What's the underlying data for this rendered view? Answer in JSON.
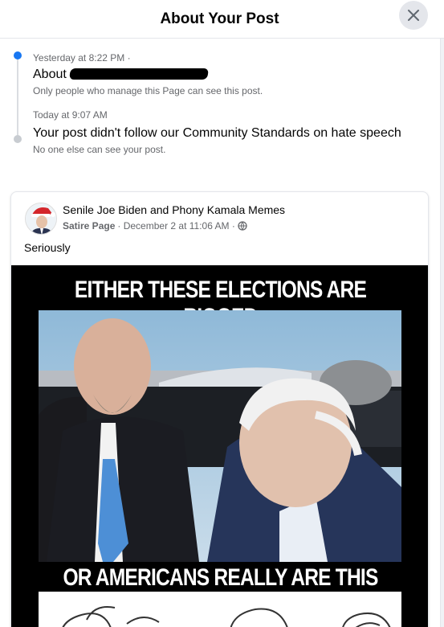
{
  "dialog": {
    "title": "About Your Post",
    "close_icon": "close-icon"
  },
  "timeline": [
    {
      "time": "Yesterday at 8:22 PM ·",
      "title": "About",
      "subtitle": "Only people who manage this Page can see this post."
    },
    {
      "time": "Today at 9:07 AM",
      "title": "Your post didn't follow our Community Standards on hate speech",
      "subtitle": "No one else can see your post."
    }
  ],
  "post": {
    "page_name": "Senile Joe Biden and Phony Kamala Memes",
    "category": "Satire Page",
    "date": "· December 2 at 11:06 AM ·",
    "audience_icon": "globe-icon",
    "caption": "Seriously",
    "meme_top_text": "EITHER THESE ELECTIONS ARE RIGGED",
    "meme_bottom_text": "OR AMERICANS REALLY ARE THIS STUPID"
  },
  "colors": {
    "accent": "#1877f2",
    "secondary_text": "#65676b",
    "divider": "#e4e6eb"
  }
}
